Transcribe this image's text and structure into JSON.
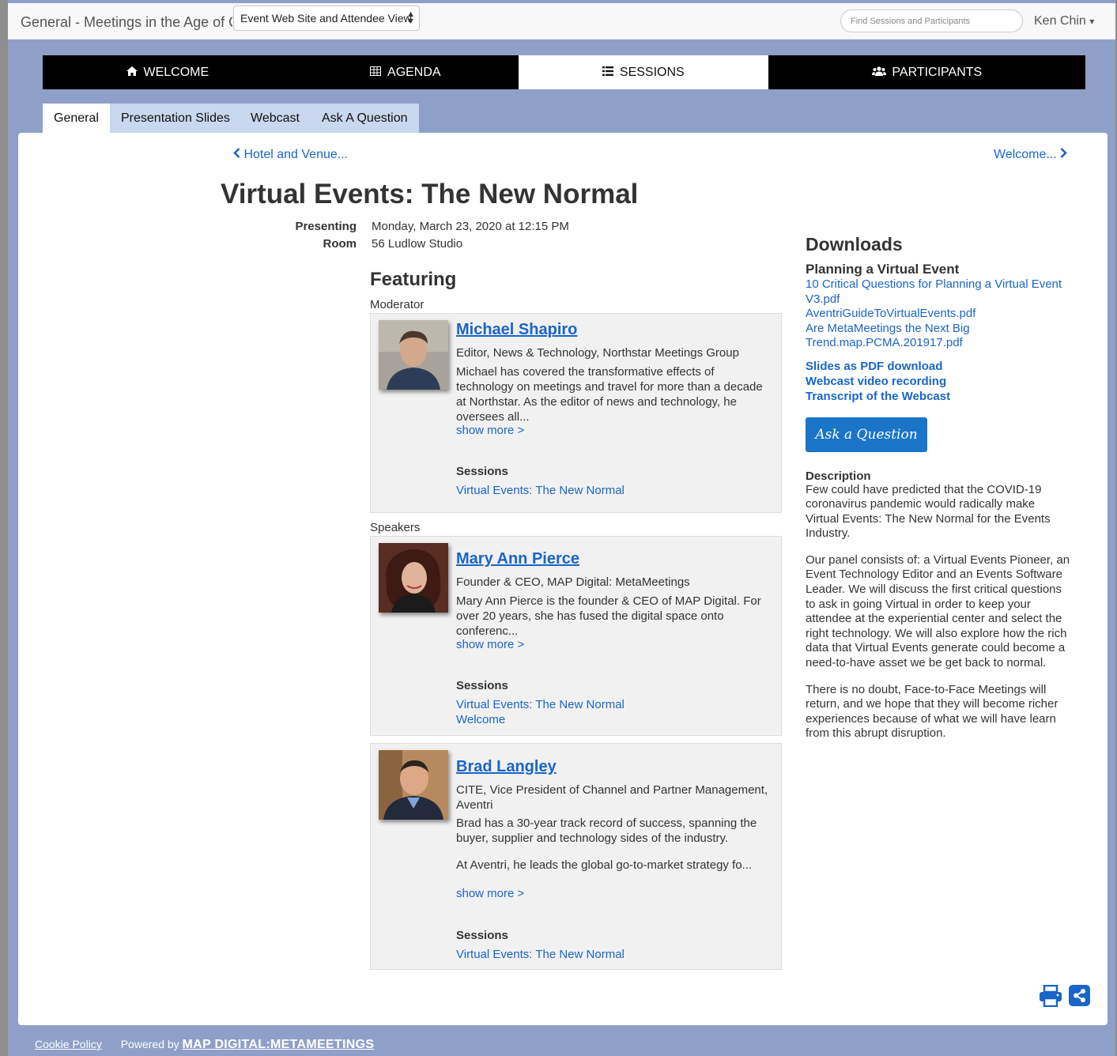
{
  "topbar": {
    "event_title": "General - Meetings in the Age of C",
    "view_select": "Event Web Site and Attendee View",
    "search_placeholder": "Find Sessions and Participants",
    "user_name": "Ken Chin",
    "user_caret": "▾"
  },
  "nav": {
    "items": [
      {
        "label": "WELCOME",
        "icon": "home-icon"
      },
      {
        "label": "AGENDA",
        "icon": "table-icon"
      },
      {
        "label": "SESSIONS",
        "icon": "list-icon"
      },
      {
        "label": "PARTICIPANTS",
        "icon": "users-icon"
      }
    ],
    "active": "SESSIONS"
  },
  "subtabs": [
    "General",
    "Presentation Slides",
    "Webcast",
    "Ask A Question"
  ],
  "pager": {
    "prev": "Hotel and Venue...",
    "next": "Welcome..."
  },
  "session": {
    "title": "Virtual Events: The New Normal",
    "presenting_label": "Presenting",
    "presenting_value": "Monday, March 23, 2020 at 12:15 PM",
    "room_label": "Room",
    "room_value": "56 Ludlow Studio"
  },
  "featuring": {
    "heading": "Featuring",
    "moderator_label": "Moderator",
    "speakers_label": "Speakers",
    "sessions_heading": "Sessions",
    "show_more": "show more >",
    "people": [
      {
        "name": "Michael Shapiro",
        "role": "Editor, News & Technology, Northstar Meetings Group",
        "bio": "Michael has covered the transformative effects of technology on meetings and travel for more than a decade at Northstar. As the editor of news and technology, he oversees all...",
        "sessions": [
          "Virtual Events: The New Normal"
        ]
      },
      {
        "name": "Mary Ann Pierce",
        "role": "Founder & CEO, MAP Digital: MetaMeetings",
        "bio": "Mary Ann Pierce is the founder & CEO of MAP Digital. For over 20 years, she has fused the digital space onto conferenc...",
        "sessions": [
          "Virtual Events: The New Normal",
          "Welcome"
        ]
      },
      {
        "name": "Brad Langley",
        "role": "CITE, Vice President of Channel and Partner Management, Aventri",
        "bio": "Brad has a 30-year track record of success, spanning the buyer, supplier and technology sides of the industry.",
        "bio2": "At Aventri, he leads the global go-to-market strategy fo...",
        "sessions": [
          "Virtual Events: The New Normal"
        ]
      }
    ]
  },
  "downloads": {
    "heading": "Downloads",
    "group_title": "Planning a Virtual Event",
    "files": [
      "10 Critical Questions for Planning a Virtual Event V3.pdf",
      "AventriGuideToVirtualEvents.pdf",
      "Are MetaMeetings the Next Big Trend.map.PCMA.201917.pdf"
    ],
    "links": [
      "Slides as PDF download",
      "Webcast video recording",
      "Transcript of the Webcast"
    ],
    "ask_button": "Ask a Question"
  },
  "description": {
    "heading": "Description",
    "paragraphs": [
      "Few could have predicted that the COVID-19 coronavirus pandemic would radically make Virtual Events: The New Normal for the Events Industry.",
      "Our panel consists of: a Virtual Events Pioneer, an Event Technology Editor and an Events Software Leader. We will discuss the first critical questions to ask in going Virtual in order to keep your attendee at the experiential center and select the right technology. We will also explore how the rich data that Virtual Events generate could become a need-to-have asset we be get back to normal.",
      "There is no doubt, Face-to-Face Meetings will return, and we hope that they will become richer experiences because of what we will have learn from this abrupt disruption."
    ]
  },
  "footer": {
    "cookie": "Cookie Policy",
    "powered_by": "Powered by",
    "brand": "MAP DIGITAL:METAMEETINGS"
  },
  "colors": {
    "link": "#1a65c8",
    "page_bg": "#8fa0c8",
    "nav_bg": "#000000",
    "subtab_bg": "#c9d7ef",
    "button": "#1a75c8"
  }
}
